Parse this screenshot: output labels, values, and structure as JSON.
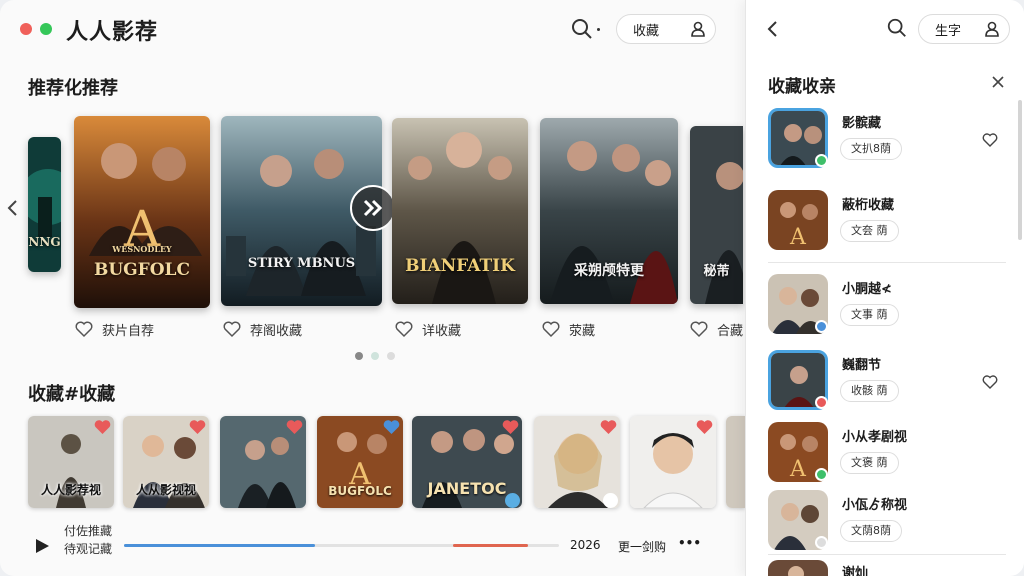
{
  "app": {
    "title": "人人影荐"
  },
  "header": {
    "favorites_label": "收藏"
  },
  "sections": {
    "recommended_title": "推荐化推荐",
    "favorites_title": "收藏#收藏"
  },
  "recommended": [
    {
      "poster_title": "NNG",
      "caption": ""
    },
    {
      "poster_title": "BUGFOLC",
      "poster_sub": "WESNODLEY",
      "caption": "获片自荐"
    },
    {
      "poster_title": "STIRY MBNUS",
      "caption": "荐阁收藏"
    },
    {
      "poster_title": "BIANFATIK",
      "caption": "详收藏"
    },
    {
      "poster_title": "采朔颅特更",
      "caption": "荥藏"
    },
    {
      "poster_title": "秘芾",
      "caption": "合藏"
    }
  ],
  "favorites": [
    {
      "label": "人人影荐视",
      "heart": "#e85a5a"
    },
    {
      "label": "人从影视视",
      "heart": "#e85a5a"
    },
    {
      "label": "",
      "heart": "#e85a5a"
    },
    {
      "label": "BUGFOLC",
      "heart": "#4a90d9"
    },
    {
      "label": "JANETOC",
      "heart": "#e85a5a"
    },
    {
      "label": "",
      "heart": "#e85a5a"
    },
    {
      "label": "",
      "heart": "#e85a5a"
    }
  ],
  "player": {
    "line1": "付佐推藏",
    "line2": "待观记藏",
    "date": "2026",
    "status": "更一剑购",
    "more": "•••",
    "progress": 0.44
  },
  "sidebar": {
    "pill_label": "生字",
    "title": "收藏收亲",
    "items": [
      {
        "name": "影髌藏",
        "tag": "文扒8荫",
        "badge": "#3fbf6a",
        "liked": true
      },
      {
        "name": "蔽桁收藏",
        "tag": "文夽  荫",
        "badge": "",
        "liked": false
      },
      {
        "name": "小胴越≮",
        "tag": "文事  荫",
        "badge": "#4a90d9",
        "liked": false
      },
      {
        "name": "巍翻节",
        "tag": "收骸  荫",
        "badge": "#e85a5a",
        "liked": true
      },
      {
        "name": "小从孝剧视",
        "tag": "文褒  荫",
        "badge": "#3fbf6a",
        "liked": false
      },
      {
        "name": "小佤ゟ称视",
        "tag": "文荫8荫",
        "badge": "#dddddd",
        "liked": false
      },
      {
        "name": "谢灿",
        "tag": "",
        "badge": "",
        "liked": false
      }
    ]
  },
  "colors": {
    "accent_blue": "#4a90d9",
    "accent_red": "#e0654f",
    "close_dot": "#f0605a",
    "green_dot": "#35c759"
  }
}
